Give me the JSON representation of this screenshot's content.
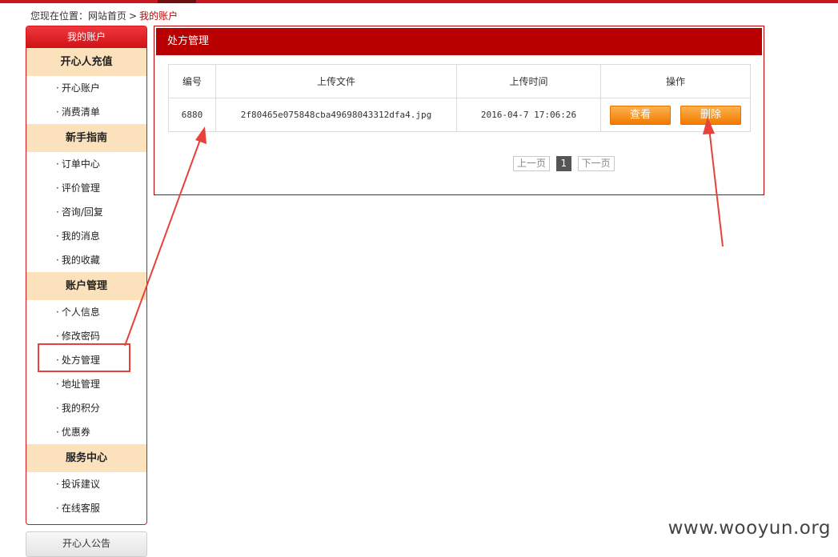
{
  "breadcrumb": {
    "prefix": "您现在位置：",
    "home": "网站首页",
    "separator": ">",
    "current": "我的账户"
  },
  "sidebar": {
    "title": "我的账户",
    "sections": [
      {
        "title": "开心人充值",
        "items": [
          "开心账户",
          "消费清单"
        ]
      },
      {
        "title": "新手指南",
        "items": [
          "订单中心",
          "评价管理",
          "咨询/回复",
          "我的消息",
          "我的收藏"
        ]
      },
      {
        "title": "账户管理",
        "items": [
          "个人信息",
          "修改密码",
          "处方管理",
          "地址管理",
          "我的积分",
          "优惠券"
        ]
      },
      {
        "title": "服务中心",
        "items": [
          "投诉建议",
          "在线客服"
        ]
      }
    ],
    "notice_title": "开心人公告"
  },
  "main": {
    "title": "处方管理",
    "table": {
      "headers": [
        "编号",
        "上传文件",
        "上传时间",
        "操作"
      ],
      "rows": [
        {
          "id": "6880",
          "file": "2f80465e075848cba49698043312dfa4.jpg",
          "time": "2016-04-7 17:06:26",
          "view_label": "查看",
          "delete_label": "删除"
        }
      ]
    },
    "pager": {
      "prev": "上一页",
      "current": "1",
      "next": "下一页"
    }
  },
  "watermark": "www.wooyun.org",
  "colors": {
    "brand_red": "#c81623",
    "section_bg": "#fbe2bd",
    "button_orange": "#f58a0b",
    "annotation": "#e8413b"
  }
}
